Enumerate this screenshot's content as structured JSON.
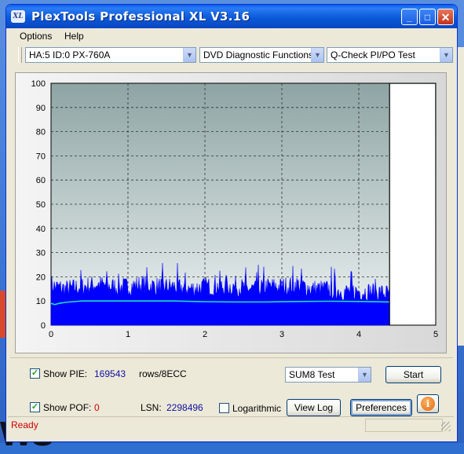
{
  "window": {
    "title": "PlexTools Professional XL V3.16",
    "app_icon_text": "XL",
    "minimize_glyph": "_",
    "maximize_glyph": "□",
    "close_glyph": "✕"
  },
  "menu": [
    "Options",
    "Help"
  ],
  "toolbar": {
    "drive": "HA:5 ID:0  PX-760A",
    "function": "DVD Diagnostic Functions",
    "test": "Q-Check PI/PO Test"
  },
  "chart_data": {
    "type": "area",
    "x_ticks": [
      "0",
      "1",
      "2",
      "3",
      "4",
      "5"
    ],
    "y_ticks": [
      "0",
      "10",
      "20",
      "30",
      "40",
      "50",
      "60",
      "70",
      "80",
      "90",
      "100"
    ],
    "xlim": [
      0,
      5
    ],
    "ylim": [
      0,
      100
    ],
    "grid": true,
    "end_marker_x": 4.4,
    "series": [
      {
        "color": "#0000ff",
        "x": [
          0,
          0.05,
          0.2,
          0.4,
          0.6,
          0.8,
          1.0,
          1.2,
          1.4,
          1.6,
          1.8,
          2.0,
          2.2,
          2.4,
          2.6,
          2.8,
          3.0,
          3.2,
          3.4,
          3.6,
          3.8,
          4.0,
          4.2,
          4.4
        ],
        "y": [
          17,
          16,
          15,
          16,
          17,
          16,
          16,
          17,
          16,
          16,
          15,
          16,
          16,
          16,
          15,
          16,
          16,
          17,
          15,
          15,
          14,
          14,
          14,
          13
        ]
      },
      {
        "color": "#20e0c0",
        "x": [
          0,
          0.05,
          0.1,
          0.2,
          0.4,
          0.8,
          1.2,
          1.6,
          2.0,
          2.4,
          2.8,
          3.2,
          3.6,
          4.0,
          4.4
        ],
        "y": [
          9,
          8.5,
          9,
          9.5,
          10,
          10,
          10,
          10,
          9.7,
          9.6,
          9.6,
          9.8,
          9.9,
          9.8,
          9.6
        ]
      }
    ]
  },
  "controls": {
    "show_pie_label": "Show PIE:",
    "pie_value": "169543",
    "pie_unit": "rows/8ECC",
    "show_pof_label": "Show POF:",
    "pof_value": "0",
    "lsn_label": "LSN:",
    "lsn_value": "2298496",
    "logarithmic_label": "Logarithmic",
    "sum_select": "SUM8 Test",
    "start_button": "Start",
    "view_log_button": "View Log",
    "preferences_button": "Preferences",
    "info_glyph": "i",
    "check_glyph": "✓"
  },
  "status": {
    "text": "Ready"
  },
  "desktop": {
    "text": "WS"
  },
  "colors": {
    "titlebar": "#0b5ad9",
    "plot_bg_top": "#8ea4a4",
    "plot_bg_bottom": "#eef3f3",
    "pie_fill": "#0000ff",
    "po_line": "#20e0c0",
    "status_text": "#d00000"
  }
}
